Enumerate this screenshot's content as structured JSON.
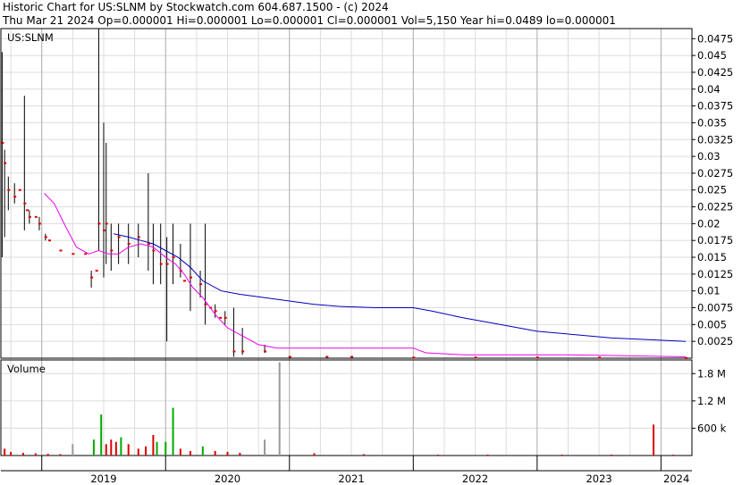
{
  "header": {
    "line1": "Historic Chart for US:SLNM by Stockwatch.com 604.687.1500 - (c) 2024",
    "line2": "Thu Mar 21 2024   Op=0.000001   Hi=0.000001   Lo=0.000001   Cl=0.000001   Vol=5,150   Year hi=0.0489   lo=0.000001"
  },
  "colors": {
    "price_bar": "#000000",
    "close_dot": "#dd0000",
    "ma_short": "#ee00ee",
    "ma_long": "#0000bb",
    "vol_up": "#00aa00",
    "vol_down": "#dd0000",
    "vol_neutral": "#999999",
    "grid": "#dcdcdc"
  },
  "chart_data": [
    {
      "type": "line",
      "title": "US:SLNM",
      "x_years": [
        "2019",
        "2020",
        "2021",
        "2022",
        "2023",
        "2024"
      ],
      "x_range": [
        2018.67,
        2024.25
      ],
      "y_ticks": [
        "0.0025",
        "0.005",
        "0.0075",
        "0.01",
        "0.0125",
        "0.015",
        "0.0175",
        "0.02",
        "0.0225",
        "0.025",
        "0.0275",
        "0.03",
        "0.0325",
        "0.035",
        "0.0375",
        "0.04",
        "0.0425",
        "0.045",
        "0.0475"
      ],
      "ylim": [
        0,
        0.049
      ],
      "grid": true,
      "price_bars": [
        {
          "x": 2018.68,
          "lo": 0.015,
          "hi": 0.0455,
          "c": 0.032
        },
        {
          "x": 2018.7,
          "lo": 0.018,
          "hi": 0.031,
          "c": 0.029
        },
        {
          "x": 2018.73,
          "lo": 0.022,
          "hi": 0.027,
          "c": 0.025
        },
        {
          "x": 2018.78,
          "lo": 0.023,
          "hi": 0.026,
          "c": 0.024
        },
        {
          "x": 2018.86,
          "lo": 0.019,
          "hi": 0.039,
          "c": 0.023
        },
        {
          "x": 2018.9,
          "lo": 0.02,
          "hi": 0.022,
          "c": 0.021
        },
        {
          "x": 2018.98,
          "lo": 0.019,
          "hi": 0.021,
          "c": 0.02
        },
        {
          "x": 2019.03,
          "lo": 0.0175,
          "hi": 0.0185,
          "c": 0.018
        },
        {
          "x": 2019.4,
          "lo": 0.0105,
          "hi": 0.013,
          "c": 0.012
        },
        {
          "x": 2019.46,
          "lo": 0.016,
          "hi": 0.049,
          "c": 0.02
        },
        {
          "x": 2019.5,
          "lo": 0.012,
          "hi": 0.035,
          "c": 0.019
        },
        {
          "x": 2019.52,
          "lo": 0.014,
          "hi": 0.032,
          "c": 0.02
        },
        {
          "x": 2019.56,
          "lo": 0.013,
          "hi": 0.02,
          "c": 0.016
        },
        {
          "x": 2019.62,
          "lo": 0.014,
          "hi": 0.02,
          "c": 0.018
        },
        {
          "x": 2019.7,
          "lo": 0.014,
          "hi": 0.02,
          "c": 0.017
        },
        {
          "x": 2019.78,
          "lo": 0.015,
          "hi": 0.02,
          "c": 0.018
        },
        {
          "x": 2019.86,
          "lo": 0.013,
          "hi": 0.0275,
          "c": 0.017
        },
        {
          "x": 2019.9,
          "lo": 0.011,
          "hi": 0.02,
          "c": 0.016
        },
        {
          "x": 2019.96,
          "lo": 0.011,
          "hi": 0.02,
          "c": 0.014
        },
        {
          "x": 2020.01,
          "lo": 0.0025,
          "hi": 0.018,
          "c": 0.014
        },
        {
          "x": 2020.06,
          "lo": 0.011,
          "hi": 0.02,
          "c": 0.015
        },
        {
          "x": 2020.12,
          "lo": 0.012,
          "hi": 0.017,
          "c": 0.013
        },
        {
          "x": 2020.2,
          "lo": 0.007,
          "hi": 0.02,
          "c": 0.012
        },
        {
          "x": 2020.28,
          "lo": 0.009,
          "hi": 0.013,
          "c": 0.011
        },
        {
          "x": 2020.32,
          "lo": 0.005,
          "hi": 0.02,
          "c": 0.008
        },
        {
          "x": 2020.4,
          "lo": 0.006,
          "hi": 0.008,
          "c": 0.007
        },
        {
          "x": 2020.48,
          "lo": 0.005,
          "hi": 0.007,
          "c": 0.006
        },
        {
          "x": 2020.55,
          "lo": 0.0002,
          "hi": 0.0075,
          "c": 0.001
        },
        {
          "x": 2020.62,
          "lo": 0.0005,
          "hi": 0.0045,
          "c": 0.001
        },
        {
          "x": 2020.8,
          "lo": 0.0008,
          "hi": 0.002,
          "c": 0.001
        }
      ],
      "closes": [
        {
          "x": 2018.82,
          "c": 0.025
        },
        {
          "x": 2018.88,
          "c": 0.022
        },
        {
          "x": 2018.95,
          "c": 0.021
        },
        {
          "x": 2019.06,
          "c": 0.0175
        },
        {
          "x": 2019.15,
          "c": 0.016
        },
        {
          "x": 2019.25,
          "c": 0.0155
        },
        {
          "x": 2019.35,
          "c": 0.0155
        },
        {
          "x": 2019.44,
          "c": 0.013
        },
        {
          "x": 2020.15,
          "c": 0.0115
        },
        {
          "x": 2020.36,
          "c": 0.0075
        },
        {
          "x": 2020.44,
          "c": 0.006
        },
        {
          "x": 2021.0,
          "c": 0.0002
        },
        {
          "x": 2021.3,
          "c": 0.0002
        },
        {
          "x": 2021.5,
          "c": 0.0002
        },
        {
          "x": 2022.0,
          "c": 0.0001
        },
        {
          "x": 2022.5,
          "c": 0.0001
        },
        {
          "x": 2023.0,
          "c": 0.0001
        },
        {
          "x": 2023.5,
          "c": 0.0001
        },
        {
          "x": 2024.2,
          "c": 1e-05
        }
      ],
      "ma_short": [
        [
          2019.02,
          0.0245
        ],
        [
          2019.1,
          0.023
        ],
        [
          2019.18,
          0.02
        ],
        [
          2019.28,
          0.0165
        ],
        [
          2019.38,
          0.0155
        ],
        [
          2019.46,
          0.016
        ],
        [
          2019.54,
          0.0155
        ],
        [
          2019.62,
          0.0155
        ],
        [
          2019.7,
          0.0165
        ],
        [
          2019.8,
          0.017
        ],
        [
          2019.9,
          0.0165
        ],
        [
          2020.0,
          0.015
        ],
        [
          2020.08,
          0.014
        ],
        [
          2020.15,
          0.0125
        ],
        [
          2020.22,
          0.0105
        ],
        [
          2020.3,
          0.009
        ],
        [
          2020.4,
          0.0065
        ],
        [
          2020.5,
          0.0045
        ],
        [
          2020.6,
          0.0035
        ],
        [
          2020.75,
          0.002
        ],
        [
          2020.9,
          0.0015
        ],
        [
          2021.1,
          0.0015
        ],
        [
          2021.3,
          0.0015
        ],
        [
          2021.5,
          0.0015
        ],
        [
          2021.8,
          0.0015
        ],
        [
          2022.0,
          0.0015
        ],
        [
          2022.1,
          0.0008
        ],
        [
          2022.4,
          0.0005
        ],
        [
          2022.8,
          0.0005
        ],
        [
          2023.2,
          0.0005
        ],
        [
          2023.6,
          0.0004
        ],
        [
          2024.2,
          0.0002
        ]
      ],
      "ma_long": [
        [
          2019.58,
          0.0185
        ],
        [
          2019.7,
          0.018
        ],
        [
          2019.8,
          0.0175
        ],
        [
          2019.9,
          0.017
        ],
        [
          2020.0,
          0.016
        ],
        [
          2020.1,
          0.015
        ],
        [
          2020.2,
          0.0135
        ],
        [
          2020.3,
          0.0115
        ],
        [
          2020.45,
          0.01
        ],
        [
          2020.6,
          0.0095
        ],
        [
          2020.8,
          0.009
        ],
        [
          2021.0,
          0.0085
        ],
        [
          2021.2,
          0.008
        ],
        [
          2021.4,
          0.0077
        ],
        [
          2021.7,
          0.0075
        ],
        [
          2022.0,
          0.0075
        ],
        [
          2022.15,
          0.007
        ],
        [
          2022.4,
          0.006
        ],
        [
          2022.7,
          0.005
        ],
        [
          2023.0,
          0.004
        ],
        [
          2023.3,
          0.0035
        ],
        [
          2023.6,
          0.003
        ],
        [
          2024.2,
          0.0025
        ]
      ]
    },
    {
      "type": "bar",
      "title": "Volume",
      "y_ticks": [
        "600 k",
        "1.2 M",
        "1.8 M"
      ],
      "tick_values": [
        600000,
        1200000,
        1800000
      ],
      "ylim": [
        0,
        2100000
      ],
      "bars": [
        {
          "x": 2018.7,
          "v": 150000,
          "s": "down"
        },
        {
          "x": 2018.75,
          "v": 80000,
          "s": "down"
        },
        {
          "x": 2018.85,
          "v": 60000,
          "s": "down"
        },
        {
          "x": 2018.95,
          "v": 50000,
          "s": "down"
        },
        {
          "x": 2019.05,
          "v": 40000,
          "s": "down"
        },
        {
          "x": 2019.15,
          "v": 30000,
          "s": "down"
        },
        {
          "x": 2019.25,
          "v": 250000,
          "s": "neutral"
        },
        {
          "x": 2019.42,
          "v": 350000,
          "s": "up"
        },
        {
          "x": 2019.48,
          "v": 900000,
          "s": "up"
        },
        {
          "x": 2019.52,
          "v": 250000,
          "s": "down"
        },
        {
          "x": 2019.56,
          "v": 350000,
          "s": "down"
        },
        {
          "x": 2019.6,
          "v": 300000,
          "s": "down"
        },
        {
          "x": 2019.64,
          "v": 400000,
          "s": "up"
        },
        {
          "x": 2019.7,
          "v": 250000,
          "s": "down"
        },
        {
          "x": 2019.78,
          "v": 150000,
          "s": "down"
        },
        {
          "x": 2019.84,
          "v": 200000,
          "s": "down"
        },
        {
          "x": 2019.9,
          "v": 450000,
          "s": "down"
        },
        {
          "x": 2019.93,
          "v": 300000,
          "s": "up"
        },
        {
          "x": 2020.0,
          "v": 300000,
          "s": "up"
        },
        {
          "x": 2020.06,
          "v": 1050000,
          "s": "up"
        },
        {
          "x": 2020.12,
          "v": 150000,
          "s": "down"
        },
        {
          "x": 2020.2,
          "v": 100000,
          "s": "down"
        },
        {
          "x": 2020.3,
          "v": 200000,
          "s": "up"
        },
        {
          "x": 2020.4,
          "v": 100000,
          "s": "down"
        },
        {
          "x": 2020.5,
          "v": 80000,
          "s": "down"
        },
        {
          "x": 2020.6,
          "v": 60000,
          "s": "down"
        },
        {
          "x": 2020.8,
          "v": 350000,
          "s": "neutral"
        },
        {
          "x": 2020.92,
          "v": 2050000,
          "s": "neutral"
        },
        {
          "x": 2021.2,
          "v": 50000,
          "s": "down"
        },
        {
          "x": 2021.6,
          "v": 30000,
          "s": "down"
        },
        {
          "x": 2022.2,
          "v": 20000,
          "s": "down"
        },
        {
          "x": 2022.6,
          "v": 20000,
          "s": "down"
        },
        {
          "x": 2023.2,
          "v": 20000,
          "s": "down"
        },
        {
          "x": 2023.6,
          "v": 20000,
          "s": "down"
        },
        {
          "x": 2023.94,
          "v": 680000,
          "s": "down"
        },
        {
          "x": 2024.1,
          "v": 20000,
          "s": "down"
        }
      ]
    }
  ]
}
